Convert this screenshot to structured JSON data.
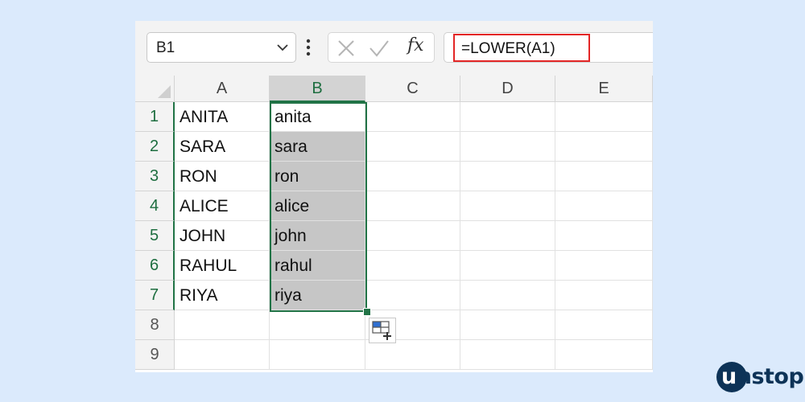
{
  "name_box": {
    "value": "B1",
    "dropdown_icon": "chevron-down-icon"
  },
  "formula_bar": {
    "options_icon": "vertical-dots-icon",
    "cancel_icon": "close-icon",
    "enter_icon": "check-icon",
    "fx_label": "fx",
    "formula": "=LOWER(A1)"
  },
  "grid": {
    "columns": [
      "A",
      "B",
      "C",
      "D",
      "E"
    ],
    "rows": [
      {
        "num": "1",
        "cells": [
          "ANITA",
          "anita",
          "",
          "",
          ""
        ]
      },
      {
        "num": "2",
        "cells": [
          "SARA",
          "sara",
          "",
          "",
          ""
        ]
      },
      {
        "num": "3",
        "cells": [
          "RON",
          "ron",
          "",
          "",
          ""
        ]
      },
      {
        "num": "4",
        "cells": [
          "ALICE",
          "alice",
          "",
          "",
          ""
        ]
      },
      {
        "num": "5",
        "cells": [
          "JOHN",
          "john",
          "",
          "",
          ""
        ]
      },
      {
        "num": "6",
        "cells": [
          "RAHUL",
          "rahul",
          "",
          "",
          ""
        ]
      },
      {
        "num": "7",
        "cells": [
          "RIYA",
          "riya",
          "",
          "",
          ""
        ]
      },
      {
        "num": "8",
        "cells": [
          "",
          "",
          "",
          "",
          ""
        ]
      },
      {
        "num": "9",
        "cells": [
          "",
          "",
          "",
          "",
          ""
        ]
      }
    ],
    "selected_range": "B1:B7",
    "quick_analysis_icon": "quick-analysis-icon"
  },
  "brand": {
    "first_letter": "u",
    "rest": "nstop"
  },
  "colors": {
    "accent": "#217346",
    "highlight": "#e32626",
    "selection_fill": "#c6c6c6",
    "background": "#dbeafc",
    "brand": "#0d3357"
  }
}
